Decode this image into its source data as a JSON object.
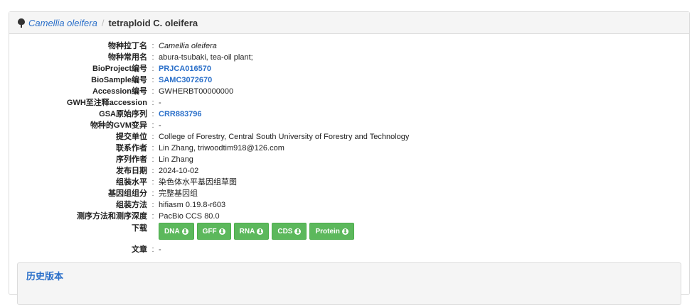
{
  "breadcrumb": {
    "icon": "tree-icon",
    "species": "Camellia oleifera",
    "separator": "/",
    "current": "tetraploid C. oleifera"
  },
  "fields": [
    {
      "label": "物种拉丁名",
      "value": "Camellia oleifera"
    },
    {
      "label": "物种常用名",
      "value": "abura-tsubaki, tea-oil plant;"
    },
    {
      "label": "BioProject编号",
      "value": "PRJCA016570"
    },
    {
      "label": "BioSample编号",
      "value": "SAMC3072670"
    },
    {
      "label": "Accession编号",
      "value": "GWHERBT00000000"
    },
    {
      "label": "GWH至注释accession",
      "value": "-"
    },
    {
      "label": "GSA原始序列",
      "value": "CRR883796"
    },
    {
      "label": "物种的GVM变异",
      "value": "-"
    },
    {
      "label": "提交单位",
      "value": "College of Forestry, Central South University of Forestry and Technology"
    },
    {
      "label": "联系作者",
      "value": "Lin Zhang, triwoodtim918@126.com"
    },
    {
      "label": "序列作者",
      "value": "Lin Zhang"
    },
    {
      "label": "发布日期",
      "value": "2024-10-02"
    },
    {
      "label": "组装水平",
      "value": "染色体水平基因组草图"
    },
    {
      "label": "基因组组分",
      "value": "完整基因组"
    },
    {
      "label": "组装方法",
      "value": "hifiasm 0.19.8-r603"
    },
    {
      "label": "测序方法和测序深度",
      "value": "PacBio CCS 80.0"
    }
  ],
  "download": {
    "label": "下载",
    "buttons": [
      "DNA",
      "GFF",
      "RNA",
      "CDS",
      "Protein"
    ],
    "icon": "download-circle-icon",
    "color": "#5cb85c"
  },
  "article": {
    "label": "文章",
    "value": "-"
  },
  "colon": ":",
  "history": {
    "title": "历史版本"
  },
  "colors": {
    "link": "#2a6fc9",
    "panel_header": "#f5f5f5"
  }
}
